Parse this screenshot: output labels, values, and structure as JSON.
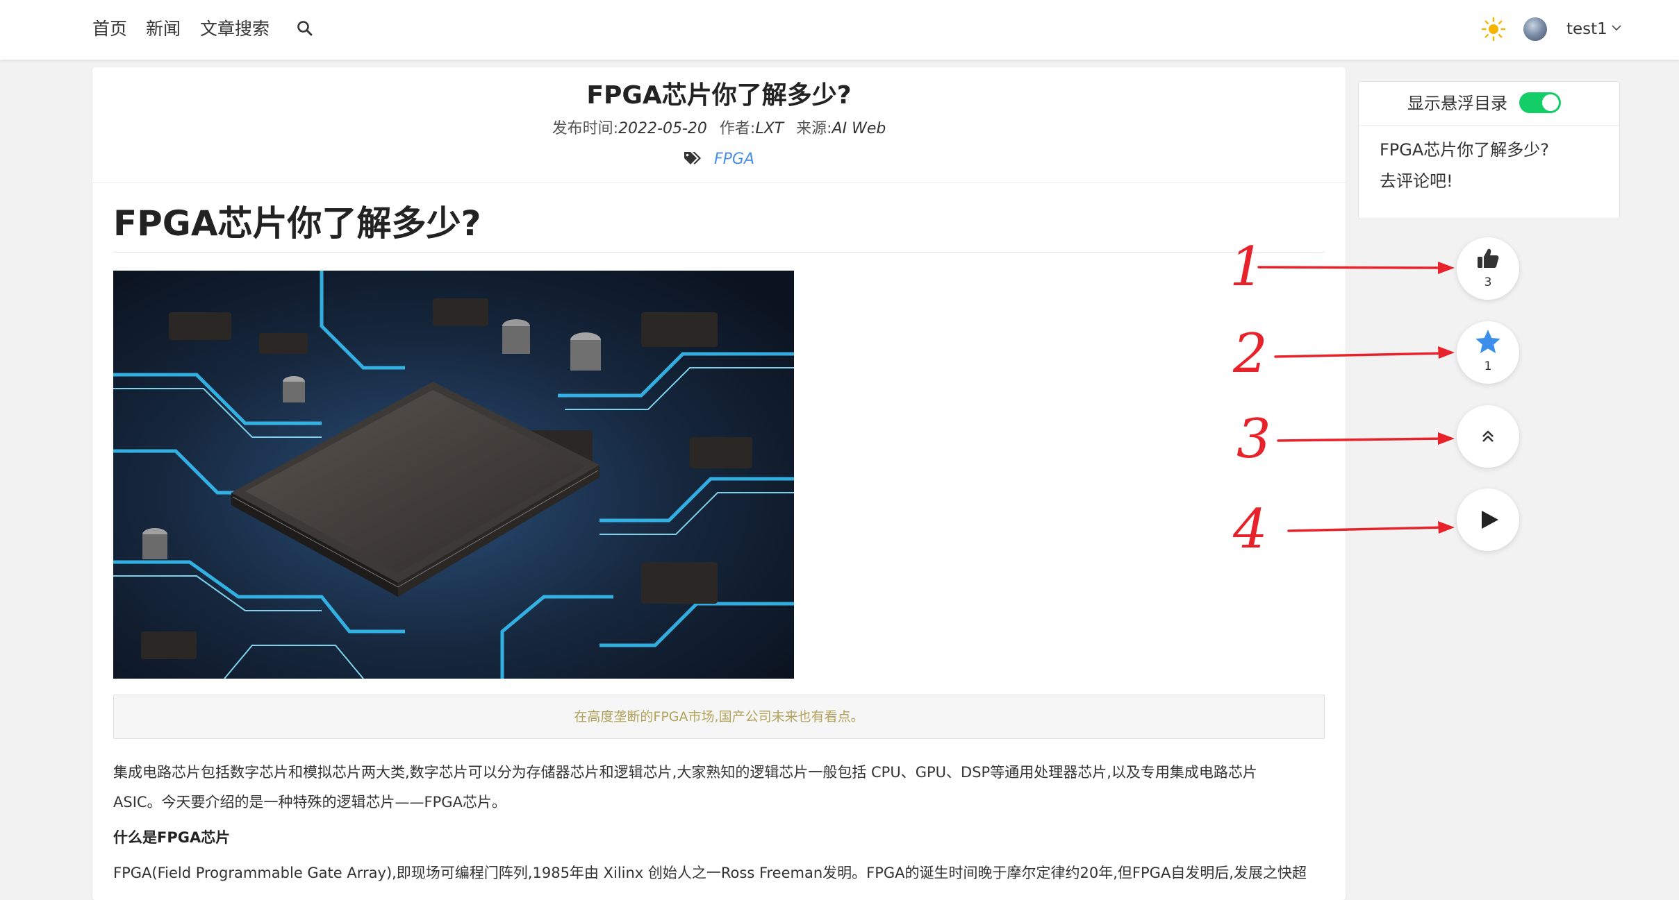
{
  "nav": {
    "items": [
      "首页",
      "新闻",
      "文章搜索"
    ],
    "search_icon": "search-icon",
    "theme_icon": "sun-icon",
    "user": {
      "name": "test1",
      "avatar": "avatar"
    }
  },
  "article": {
    "title": "FPGA芯片你了解多少?",
    "meta": {
      "publish_label": "发布时间:",
      "publish_date": "2022-05-20",
      "author_label": "作者:",
      "author": "LXT",
      "source_label": "来源:",
      "source": "AI Web"
    },
    "tag": "FPGA",
    "content_title": "FPGA芯片你了解多少?",
    "image_caption": "在高度垄断的FPGA市场,国产公司未来也有看点。",
    "paragraph_1_line_1": "集成电路芯片包括数字芯片和模拟芯片两大类,数字芯片可以分为存储器芯片和逻辑芯片,大家熟知的逻辑芯片一般包括 CPU、GPU、DSP等通用处理器芯片,以及专用集成电路芯片",
    "paragraph_1_line_2": "ASIC。今天要介绍的是一种特殊的逻辑芯片——FPGA芯片。",
    "subheading": "什么是FPGA芯片",
    "paragraph_2": "FPGA(Field Programmable Gate Array),即现场可编程门阵列,1985年由 Xilinx 创始人之一Ross Freeman发明。FPGA的诞生时间晚于摩尔定律约20年,但FPGA自发明后,发展之快超"
  },
  "toc": {
    "toggle_label": "显示悬浮目录",
    "toggle_on": true,
    "items": [
      "FPGA芯片你了解多少?",
      "去评论吧!"
    ]
  },
  "actions": {
    "like": {
      "icon": "thumbs-up-icon",
      "count": "3"
    },
    "favorite": {
      "icon": "star-icon",
      "count": "1"
    },
    "top": {
      "icon": "double-chevron-up-icon"
    },
    "play": {
      "icon": "play-icon"
    }
  },
  "annotations": [
    "1",
    "2",
    "3",
    "4"
  ],
  "colors": {
    "accent_blue": "#4a90e2",
    "toggle_green": "#13ce66",
    "annotation_red": "#e8222a",
    "caption_olive": "#b3a35a"
  }
}
